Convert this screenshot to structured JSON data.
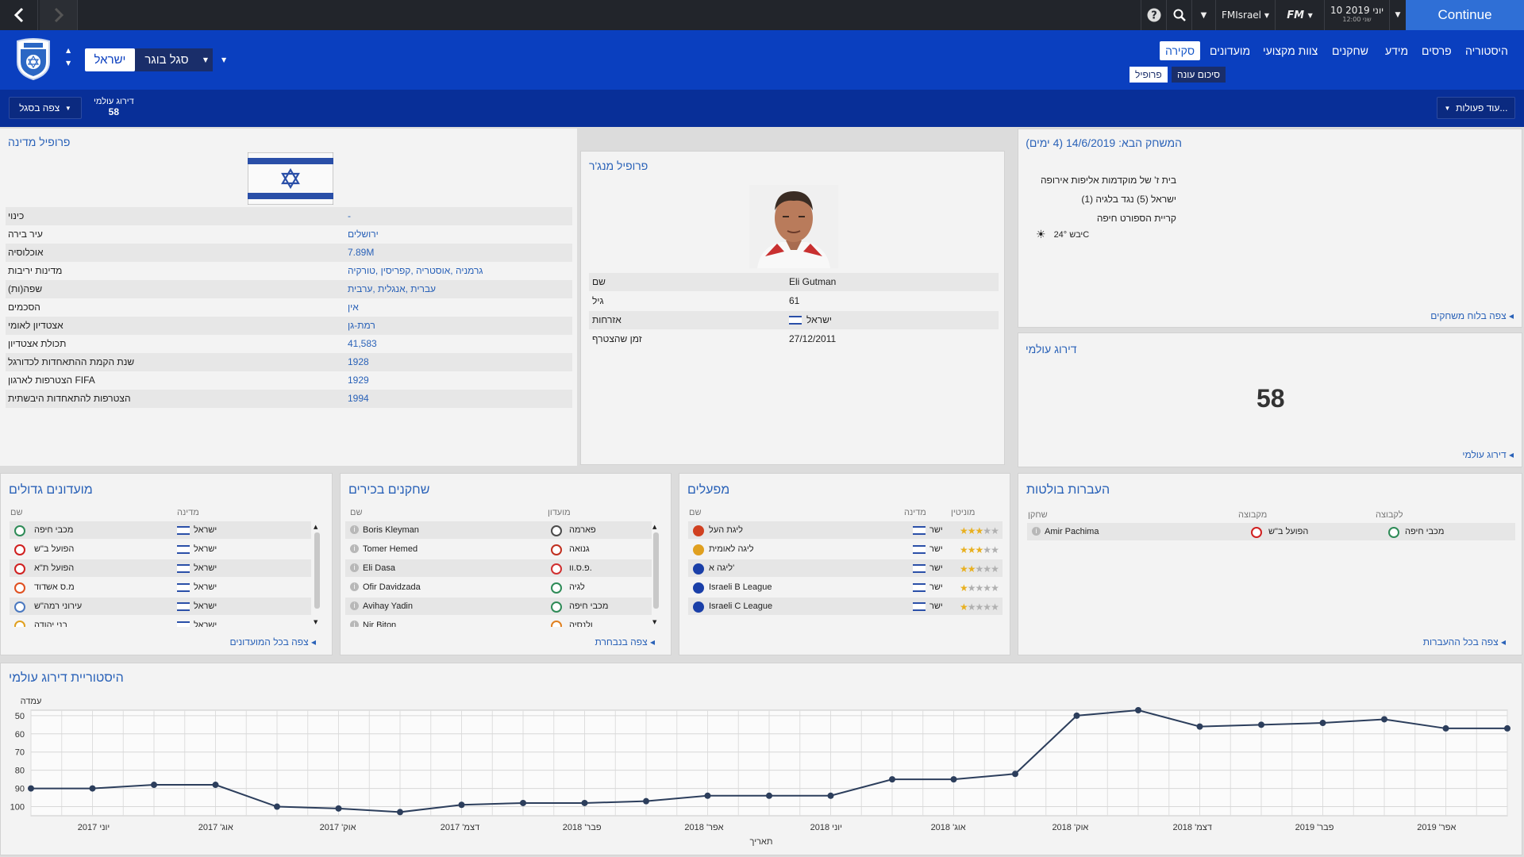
{
  "topbar": {
    "back_icon": "chevron-left-icon",
    "forward_icon": "chevron-right-icon",
    "help_icon": "question-icon",
    "search_icon": "search-icon",
    "manager_name": "FMIsrael",
    "fm_logo": "FM",
    "date": "10 יוני 2019",
    "time": "12:00 שני",
    "continue_label": "Continue"
  },
  "header": {
    "team_selector": "ישראל",
    "squad_selector": "סגל בוגר",
    "tabs": [
      "היסטוריה",
      "פרסים",
      "מידע",
      "שחקנים",
      "צוות מקצועי",
      "מועדונים",
      "סקירה"
    ],
    "subtabs": [
      "סיכום עונה",
      "פרופיל"
    ]
  },
  "subheader": {
    "more_actions": "עוד פעולות...",
    "world_rank_label": "דירוג עולמי",
    "world_rank_value": "58",
    "view_squad": "צפה בסגל"
  },
  "next_match": {
    "title": "המשחק הבא: 14/6/2019 (4 ימים)",
    "competition": "בית ז' של מוקדמות אליפות אירופה",
    "teams": "ישראל (5) נגד בלגיה (1)",
    "venue": "קריית הספורט חיפה",
    "weather": "יבש 24°C",
    "link": "צפה בלוח משחקים"
  },
  "world_rank": {
    "title": "דירוג עולמי",
    "value": "58",
    "link": "דירוג עולמי"
  },
  "manager": {
    "title": "פרופיל מנג'ר",
    "rows": [
      {
        "label": "שם",
        "value": "Eli Gutman"
      },
      {
        "label": "גיל",
        "value": "61"
      },
      {
        "label": "אזרחות",
        "value": "ישראל"
      },
      {
        "label": "זמן שהצטרף",
        "value": "27/12/2011"
      }
    ]
  },
  "country": {
    "title": "פרופיל מדינה",
    "rows": [
      {
        "label": "כינוי",
        "value": "-"
      },
      {
        "label": "עיר בירה",
        "value": "ירושלים"
      },
      {
        "label": "אוכלוסיה",
        "value": "7.89M"
      },
      {
        "label": "מדינות יריבות",
        "value": "גרמניה ,אוסטריה ,קפריסין ,טורקיה"
      },
      {
        "label": "שפה(ות)",
        "value": "עברית ,אנגלית ,ערבית"
      },
      {
        "label": "הסכמים",
        "value": "אין"
      },
      {
        "label": "אצטדיון לאומי",
        "value": "רמת-גן"
      },
      {
        "label": "תכולת אצטדיון",
        "value": "41,583"
      },
      {
        "label": "שנת הקמת ההתאחדות לכדורגל",
        "value": "1928"
      },
      {
        "label": "הצטרפות לארגון FIFA",
        "value": "1929"
      },
      {
        "label": "הצטרפות להתאחדות היבשתית",
        "value": "1994"
      }
    ]
  },
  "transfers": {
    "title": "העברות בולטות",
    "headers": {
      "to": "לקבוצה",
      "from": "מקבוצה",
      "player": "שחקן"
    },
    "rows": [
      {
        "to": "מכבי חיפה",
        "from": "הפועל ב\"ש",
        "player": "Amir Pachima"
      }
    ],
    "link": "צפה בכל ההעברות"
  },
  "competitions": {
    "title": "מפעלים",
    "headers": {
      "rep": "מוניטין",
      "nation": "מדינה",
      "name": "שם"
    },
    "rows": [
      {
        "name": "ליגת העל",
        "nation": "ישר",
        "stars": 3
      },
      {
        "name": "ליגה לאומית",
        "nation": "ישר",
        "stars": 3
      },
      {
        "name": "ליגה א'",
        "nation": "ישר",
        "stars": 2
      },
      {
        "name": "Israeli B League",
        "nation": "ישר",
        "stars": 1
      },
      {
        "name": "Israeli C League",
        "nation": "ישר",
        "stars": 1
      }
    ]
  },
  "players": {
    "title": "שחקנים בכירים",
    "headers": {
      "club": "מועדון",
      "name": "שם"
    },
    "rows": [
      {
        "club": "פארמה",
        "name": "Boris Kleyman"
      },
      {
        "club": "גנואה",
        "name": "Tomer Hemed"
      },
      {
        "club": "פ.ס.וו.",
        "name": "Eli Dasa"
      },
      {
        "club": "לגיה",
        "name": "Ofir Davidzada"
      },
      {
        "club": "מכבי חיפה",
        "name": "Avihay Yadin"
      },
      {
        "club": "ולנסיה",
        "name": "Nir Biton"
      }
    ],
    "link": "צפה בנבחרת"
  },
  "clubs": {
    "title": "מועדונים גדולים",
    "headers": {
      "nation": "מדינה",
      "name": "שם"
    },
    "rows": [
      {
        "nation": "ישראל",
        "name": "מכבי חיפה"
      },
      {
        "nation": "ישראל",
        "name": "הפועל ב\"ש"
      },
      {
        "nation": "ישראל",
        "name": "הפועל ת\"א"
      },
      {
        "nation": "ישראל",
        "name": "מ.ס אשדוד"
      },
      {
        "nation": "ישראל",
        "name": "עירוני רמה\"ש"
      },
      {
        "nation": "ישראל",
        "name": "בני יהודה"
      }
    ],
    "link": "צפה בכל המועדונים"
  },
  "colors": {
    "header": "#0a3fbf",
    "accent": "#2a62b8",
    "line": "#2c3e5c"
  },
  "chart_data": {
    "type": "line",
    "title": "היסטוריית דירוג עולמי",
    "ylabel": "עמדה",
    "xlabel": "תאריך",
    "yticks": [
      50,
      60,
      70,
      80,
      90,
      100
    ],
    "ylim": [
      47,
      105
    ],
    "y_inverted": true,
    "grid": true,
    "xtick_labels": [
      "יוני 2017",
      "אוג' 2017",
      "אוק' 2017",
      "דצמ' 2017",
      "פבר' 2018",
      "אפר' 2018",
      "יוני 2018",
      "אוג' 2018",
      "אוק' 2018",
      "דצמ' 2018",
      "פבר' 2019",
      "אפר' 2019"
    ],
    "values": [
      90,
      90,
      88,
      88,
      100,
      101,
      103,
      99,
      98,
      98,
      97,
      94,
      94,
      94,
      85,
      85,
      82,
      50,
      47,
      56,
      55,
      54,
      52,
      57,
      57
    ]
  }
}
